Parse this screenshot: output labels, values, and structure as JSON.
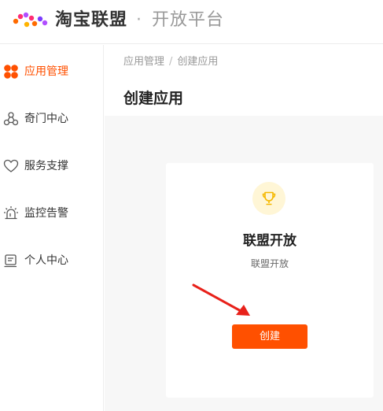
{
  "header": {
    "brand": "淘宝联盟",
    "separator": "·",
    "platform": "开放平台"
  },
  "sidebar": {
    "items": [
      {
        "label": "应用管理",
        "icon": "app-grid-icon",
        "active": true
      },
      {
        "label": "奇门中心",
        "icon": "hub-icon",
        "active": false
      },
      {
        "label": "服务支撑",
        "icon": "heart-icon",
        "active": false
      },
      {
        "label": "监控告警",
        "icon": "alarm-icon",
        "active": false
      },
      {
        "label": "个人中心",
        "icon": "profile-card-icon",
        "active": false
      }
    ]
  },
  "breadcrumb": {
    "root": "应用管理",
    "separator": "/",
    "current": "创建应用"
  },
  "page": {
    "title": "创建应用"
  },
  "card": {
    "icon": "trophy-icon",
    "title": "联盟开放",
    "subtitle": "联盟开放",
    "button_label": "创建"
  },
  "colors": {
    "accent": "#ff5000",
    "active_text": "#ff5000",
    "trophy": "#f5b800",
    "trophy_bg": "#fff6d6",
    "arrow": "#e8211a"
  }
}
